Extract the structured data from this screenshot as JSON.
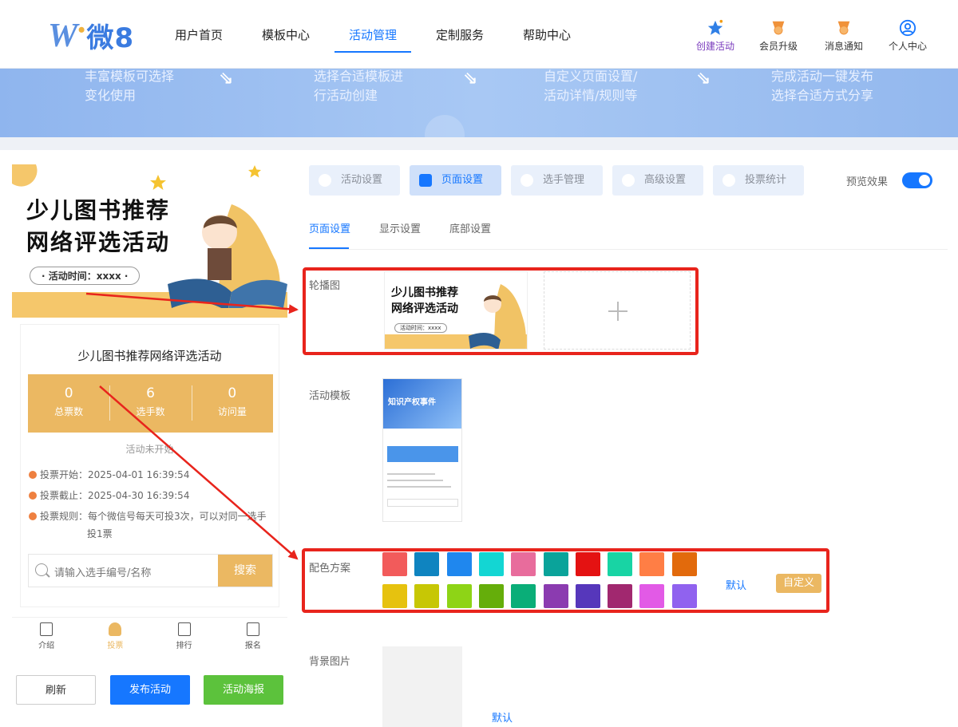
{
  "logo": {
    "mark": "W",
    "text": "微8"
  },
  "nav": {
    "items": [
      "用户首页",
      "模板中心",
      "活动管理",
      "定制服务",
      "帮助中心"
    ],
    "active_index": 2
  },
  "top_actions": [
    {
      "label": "创建活动",
      "icon": "star-icon"
    },
    {
      "label": "会员升级",
      "icon": "medal-icon"
    },
    {
      "label": "消息通知",
      "icon": "bell-medal-icon"
    },
    {
      "label": "个人中心",
      "icon": "user-circle-icon"
    }
  ],
  "banner": {
    "steps": [
      {
        "line1": "丰富模板可选择",
        "line2": "变化使用"
      },
      {
        "line1": "选择合适模板进",
        "line2": "行活动创建"
      },
      {
        "line1": "自定义页面设置/",
        "line2": "活动详情/规则等"
      },
      {
        "line1": "完成活动一键发布",
        "line2": "选择合适方式分享"
      }
    ]
  },
  "preview": {
    "poster_title_line1": "少儿图书推荐",
    "poster_title_line2": "网络评选活动",
    "poster_time": "· 活动时间：xxxx ·",
    "card_title": "少儿图书推荐网络评选活动",
    "stats": [
      {
        "value": "0",
        "label": "总票数"
      },
      {
        "value": "6",
        "label": "选手数"
      },
      {
        "value": "0",
        "label": "访问量"
      }
    ],
    "status": "活动未开始",
    "info": [
      {
        "text": "投票开始：2025-04-01 16:39:54"
      },
      {
        "text": "投票截止：2025-04-30 16:39:54"
      },
      {
        "text": "投票规则：每个微信号每天可投3次，可以对同一选手",
        "text2": "投1票"
      }
    ],
    "search_placeholder": "请输入选手编号/名称",
    "search_button": "搜索",
    "tabs": [
      {
        "label": "介绍",
        "icon": "intro-icon"
      },
      {
        "label": "投票",
        "icon": "vote-user-icon"
      },
      {
        "label": "排行",
        "icon": "rank-icon"
      },
      {
        "label": "报名",
        "icon": "signup-icon"
      }
    ],
    "active_tab_index": 1,
    "buttons": {
      "refresh": "刷新",
      "publish": "发布活动",
      "poster": "活动海报"
    }
  },
  "settings": {
    "tabs": [
      "活动设置",
      "页面设置",
      "选手管理",
      "高级设置",
      "投票统计"
    ],
    "active_tab_index": 1,
    "preview_toggle_label": "预览效果",
    "preview_toggle_on": true,
    "subtabs": [
      "页面设置",
      "显示设置",
      "底部设置"
    ],
    "active_subtab_index": 0,
    "carousel_label": "轮播图",
    "carousel_thumb": {
      "line1": "少儿图书推荐",
      "line2": "网络评选活动",
      "time": "活动时间：xxxx"
    },
    "template_label": "活动模板",
    "template_thumb_title": "知识产权事件",
    "color_label": "配色方案",
    "colors_row1": [
      "#f25b5b",
      "#0f84c0",
      "#1f87ee",
      "#13d6d3",
      "#e86c9c",
      "#0aa39a",
      "#e41212",
      "#18d4a4",
      "#ff7e45",
      "#e26a0c"
    ],
    "colors_row2": [
      "#e6c20f",
      "#c7c705",
      "#8ed416",
      "#65ae0a",
      "#0aae78",
      "#8b3bb0",
      "#5637bb",
      "#a1286f",
      "#e25ae6",
      "#9062ef"
    ],
    "color_default": "默认",
    "color_custom": "自定义",
    "bg_label": "背景图片",
    "bg_default": "默认"
  }
}
